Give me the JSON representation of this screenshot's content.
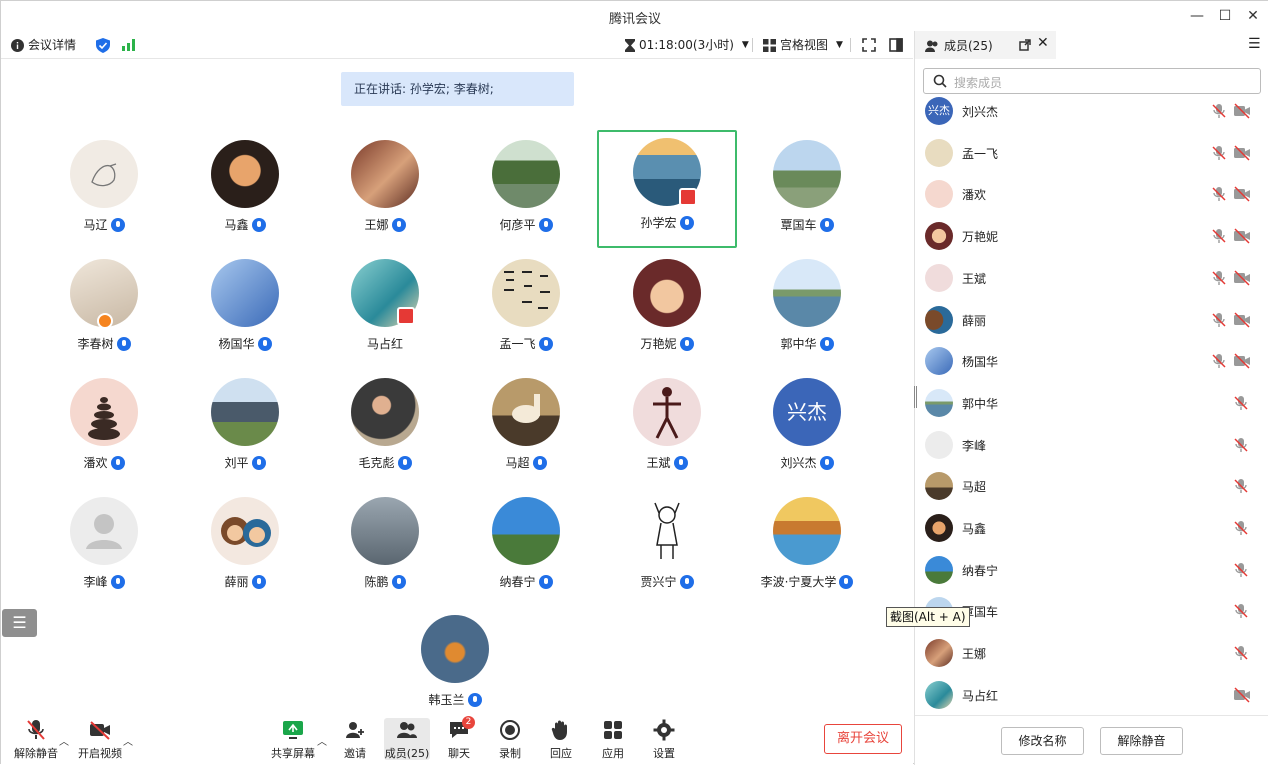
{
  "window": {
    "title": "腾讯会议"
  },
  "toolbar": {
    "meeting_info": "会议详情",
    "timer": "01:18:00(3小时)",
    "view_mode": "宫格视图"
  },
  "main": {
    "speaking": "正在讲话: 孙学宏; 李春树;",
    "participants": [
      {
        "name": "马辽"
      },
      {
        "name": "马鑫"
      },
      {
        "name": "王娜"
      },
      {
        "name": "何彦平"
      },
      {
        "name": "孙学宏"
      },
      {
        "name": "覃国车"
      },
      {
        "name": "李春树"
      },
      {
        "name": "杨国华"
      },
      {
        "name": "马占红"
      },
      {
        "name": "孟一飞"
      },
      {
        "name": "万艳妮"
      },
      {
        "name": "郭中华"
      },
      {
        "name": "潘欢"
      },
      {
        "name": "刘平"
      },
      {
        "name": "毛克彪"
      },
      {
        "name": "马超"
      },
      {
        "name": "王斌"
      },
      {
        "name": "刘兴杰"
      },
      {
        "name": "李峰"
      },
      {
        "name": "薛丽"
      },
      {
        "name": "陈鹏"
      },
      {
        "name": "纳春宁"
      },
      {
        "name": "贾兴宁"
      },
      {
        "name": "李波·宁夏大学"
      },
      {
        "name": "韩玉兰"
      }
    ],
    "avatar_text_liuxingjie": "兴杰"
  },
  "bottom": {
    "unmute": "解除静音",
    "start_video": "开启视频",
    "share": "共享屏幕",
    "invite": "邀请",
    "members": "成员(25)",
    "chat": "聊天",
    "chat_count": "2",
    "record": "录制",
    "react": "回应",
    "apps": "应用",
    "settings": "设置",
    "leave": "离开会议"
  },
  "panel": {
    "tab": "成员(25)",
    "search_placeholder": "搜索成员",
    "avatar_text_first": "兴杰",
    "members": [
      {
        "name": "刘兴杰",
        "cam_off": true
      },
      {
        "name": "孟一飞",
        "cam_off": true
      },
      {
        "name": "潘欢",
        "cam_off": true
      },
      {
        "name": "万艳妮",
        "cam_off": true
      },
      {
        "name": "王斌",
        "cam_off": true
      },
      {
        "name": "薛丽",
        "cam_off": true
      },
      {
        "name": "杨国华",
        "cam_off": true
      },
      {
        "name": "郭中华",
        "cam_off": false
      },
      {
        "name": "李峰",
        "cam_off": false
      },
      {
        "name": "马超",
        "cam_off": false
      },
      {
        "name": "马鑫",
        "cam_off": false
      },
      {
        "name": "纳春宁",
        "cam_off": false
      },
      {
        "name": "覃国车",
        "cam_off": false
      },
      {
        "name": "王娜",
        "cam_off": false
      },
      {
        "name": "马占红",
        "cam_off": true
      }
    ],
    "rename": "修改名称",
    "unmute": "解除静音"
  },
  "tooltip": "截图(Alt + A)",
  "colors": {
    "accent": "#1f6ee8",
    "leave": "#e8453c",
    "active_border": "#3dbb6b",
    "speaking_bg": "#d9e7fb"
  }
}
